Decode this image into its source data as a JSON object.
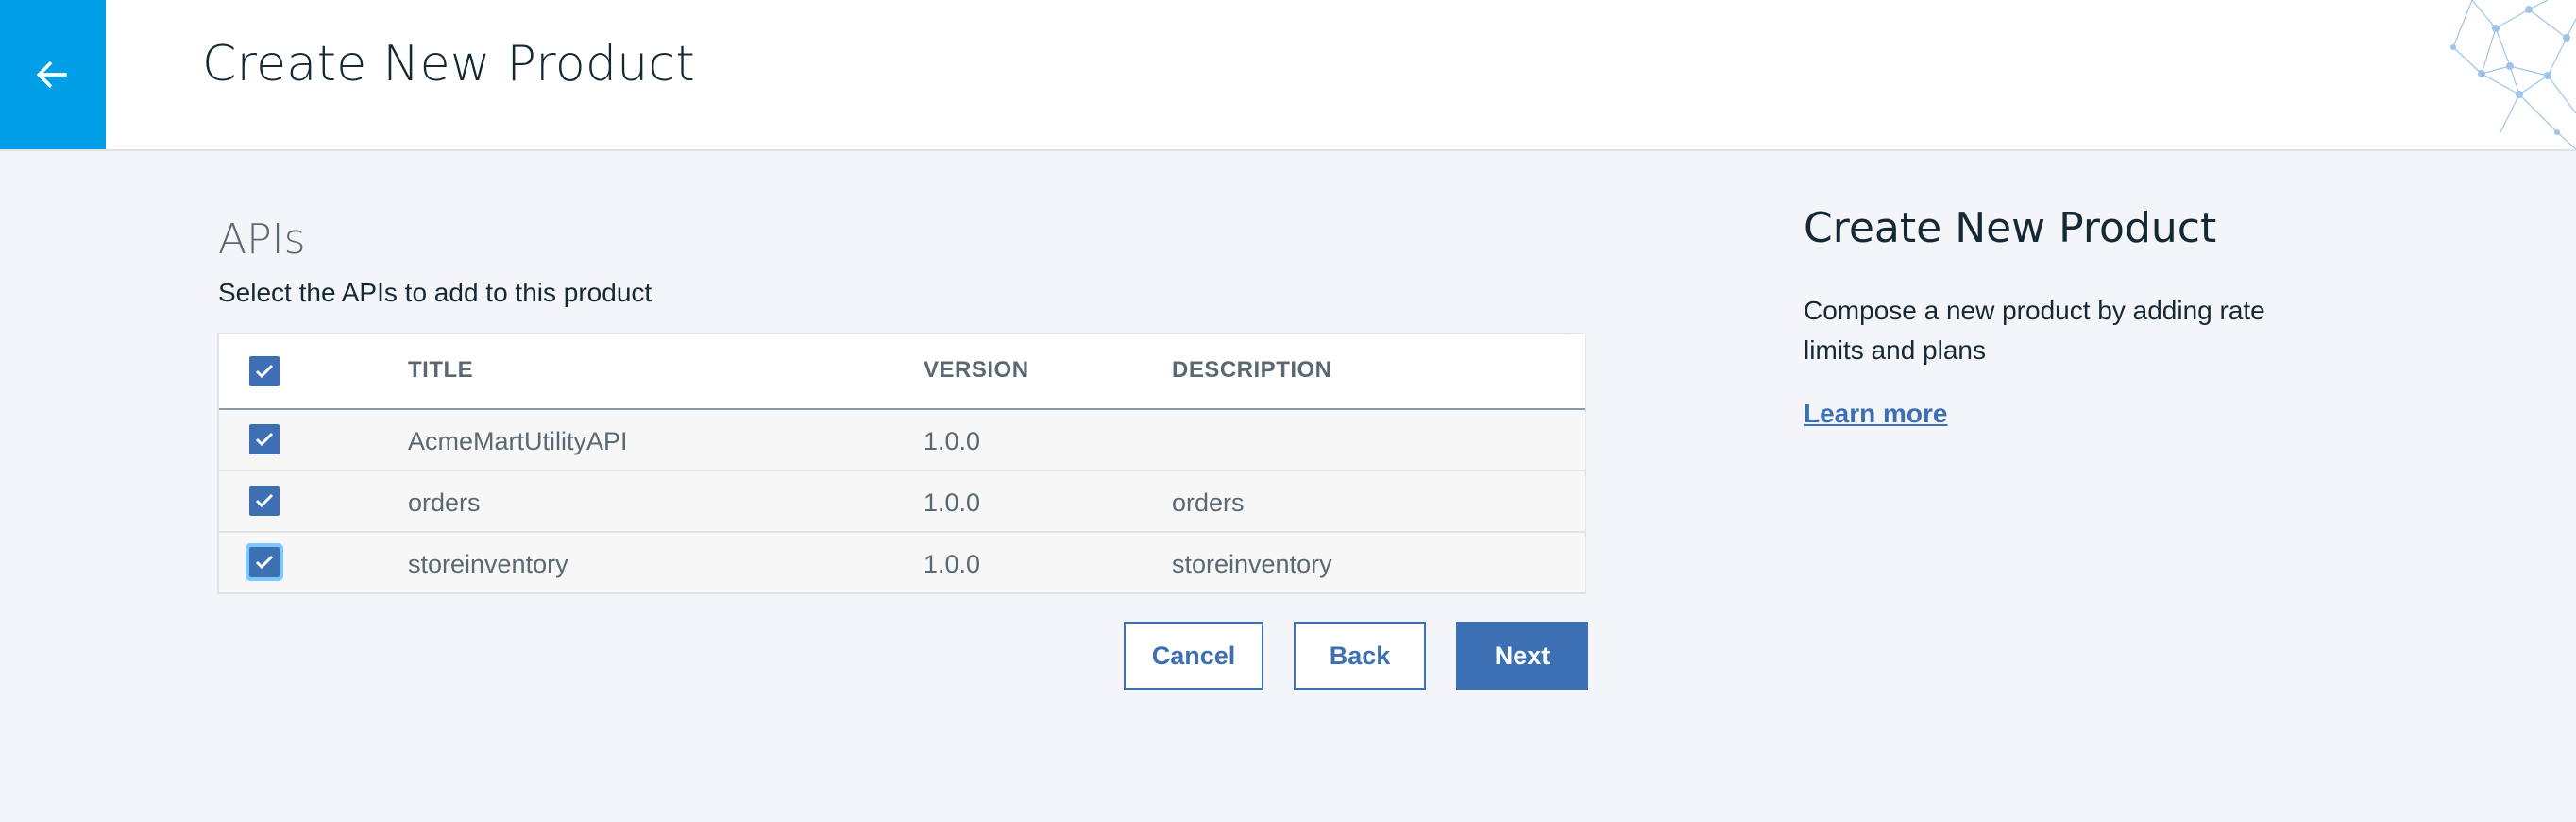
{
  "header": {
    "title": "Create New Product",
    "back_icon": "arrow-left-icon",
    "back_bg": "#009ee6"
  },
  "section": {
    "title": "APIs",
    "subtitle": "Select the APIs to add to this product"
  },
  "table": {
    "columns": [
      "TITLE",
      "VERSION",
      "DESCRIPTION"
    ],
    "select_all_checked": true,
    "rows": [
      {
        "checked": true,
        "title": "AcmeMartUtilityAPI",
        "version": "1.0.0",
        "description": ""
      },
      {
        "checked": true,
        "title": "orders",
        "version": "1.0.0",
        "description": "orders"
      },
      {
        "checked": true,
        "title": "storeinventory",
        "version": "1.0.0",
        "description": "storeinventory"
      }
    ]
  },
  "buttons": {
    "cancel": "Cancel",
    "back": "Back",
    "next": "Next"
  },
  "help": {
    "title": "Create New Product",
    "text": "Compose a new product by adding rate limits and plans",
    "link": "Learn more"
  },
  "colors": {
    "primary": "#3d70b2",
    "accent": "#009ee6",
    "background": "#f4f5f8"
  }
}
